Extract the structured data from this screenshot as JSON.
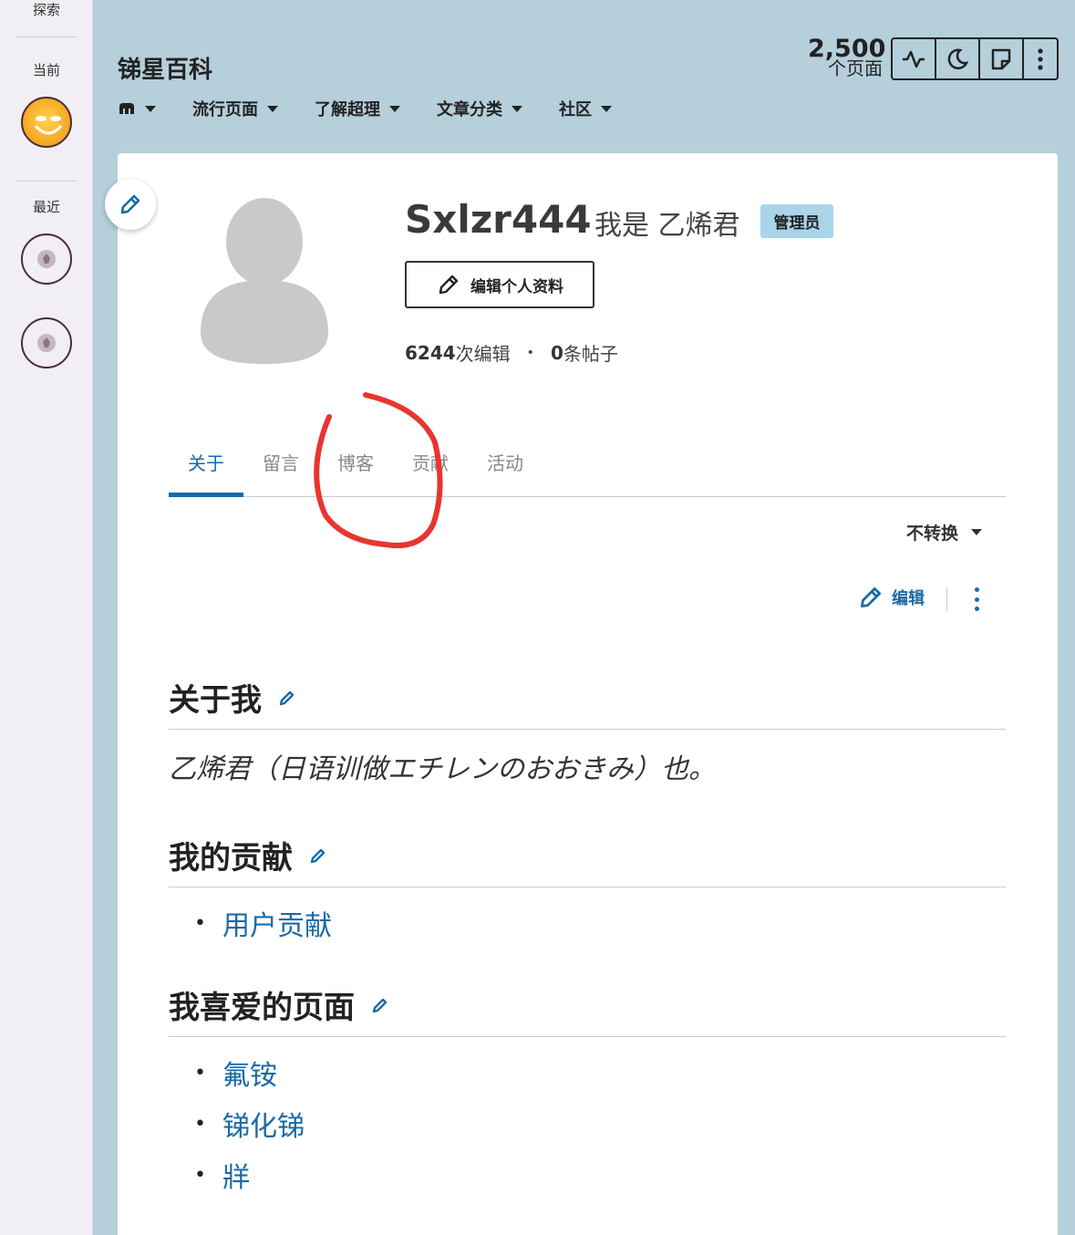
{
  "rail": {
    "explore_label": "探索",
    "current_label": "当前",
    "recent_label": "最近"
  },
  "header": {
    "wiki_title": "锑星百科",
    "nav": [
      {
        "label": "",
        "icon": "fandom-logo-icon"
      },
      {
        "label": "流行页面"
      },
      {
        "label": "了解超理"
      },
      {
        "label": "文章分类"
      },
      {
        "label": "社区"
      }
    ],
    "page_count": "2,500",
    "page_count_label": "个页面",
    "tools": [
      "activity-icon",
      "dark-mode-icon",
      "notes-icon",
      "more-icon"
    ]
  },
  "profile": {
    "username": "Sxlzr444",
    "alt_name": "我是 乙烯君",
    "badge": "管理员",
    "edit_profile_label": "编辑个人资料",
    "edits_count": "6244",
    "edits_label": "次编辑",
    "posts_count": "0",
    "posts_label": "条帖子"
  },
  "tabs": [
    {
      "label": "关于",
      "active": true
    },
    {
      "label": "留言",
      "active": false
    },
    {
      "label": "博客",
      "active": false
    },
    {
      "label": "贡献",
      "active": false
    },
    {
      "label": "活动",
      "active": false
    }
  ],
  "lang_select": "不转换",
  "edit_label": "编辑",
  "sections": {
    "about_title": "关于我",
    "about_text": "乙烯君（日语训做エチレンのおおきみ）也。",
    "contrib_title": "我的贡献",
    "contrib_items": [
      "用户贡献"
    ],
    "fav_title": "我喜爱的页面",
    "fav_items": [
      "氟铵",
      "锑化锑",
      "牂"
    ]
  },
  "colors": {
    "accent": "#1a6aa6",
    "header_bg": "#b5cfdb",
    "annotation": "#e8352f"
  }
}
